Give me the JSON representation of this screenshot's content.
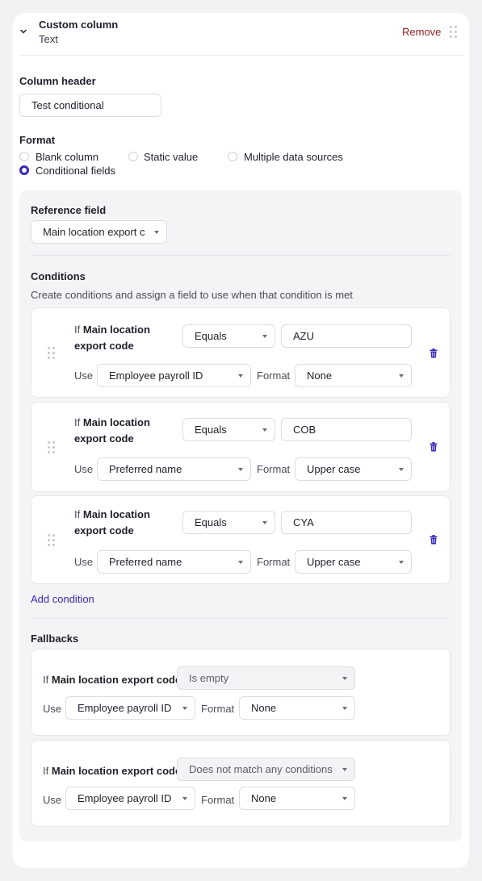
{
  "header": {
    "title": "Custom column",
    "subtitle": "Text",
    "remove_label": "Remove"
  },
  "column_header": {
    "label": "Column header",
    "value": "Test conditional"
  },
  "format": {
    "label": "Format",
    "options": [
      {
        "label": "Blank column",
        "selected": false
      },
      {
        "label": "Static value",
        "selected": false
      },
      {
        "label": "Multiple data sources",
        "selected": false
      },
      {
        "label": "Conditional fields",
        "selected": true
      }
    ]
  },
  "reference_field": {
    "label": "Reference field",
    "value": "Main location export c"
  },
  "conditions": {
    "label": "Conditions",
    "description": "Create conditions and assign a field to use when that condition is met",
    "if_word": "If",
    "field_name_line1": "Main location",
    "field_name_line2": "export code",
    "use_label": "Use",
    "format_label": "Format",
    "items": [
      {
        "operator": "Equals",
        "value": "AZU",
        "use": "Employee payroll ID",
        "format": "None"
      },
      {
        "operator": "Equals",
        "value": "COB",
        "use": "Preferred name",
        "format": "Upper case"
      },
      {
        "operator": "Equals",
        "value": "CYA",
        "use": "Preferred name",
        "format": "Upper case"
      }
    ],
    "add_label": "Add condition"
  },
  "fallbacks": {
    "label": "Fallbacks",
    "if_word": "If",
    "field_name": "Main location export code",
    "use_label": "Use",
    "format_label": "Format",
    "items": [
      {
        "condition": "Is empty",
        "use": "Employee payroll ID",
        "format": "None"
      },
      {
        "condition": "Does not match any conditions",
        "use": "Employee payroll ID",
        "format": "None"
      }
    ]
  },
  "colors": {
    "accent": "#3729b8",
    "danger": "#9a1b1b",
    "panel_bg": "#f4f4f6"
  }
}
